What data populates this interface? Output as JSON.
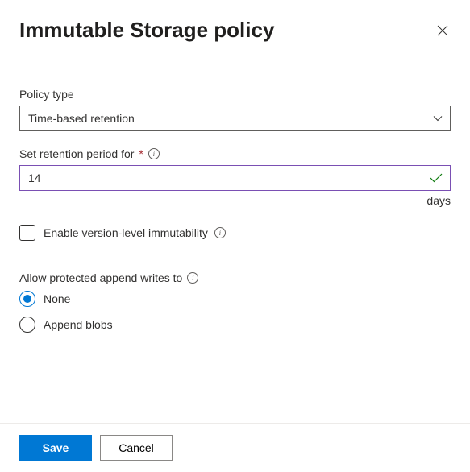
{
  "dialog": {
    "title": "Immutable Storage policy"
  },
  "fields": {
    "policy_type": {
      "label": "Policy type",
      "value": "Time-based retention"
    },
    "retention": {
      "label": "Set retention period for",
      "value": "14",
      "unit": "days"
    },
    "version_immutability": {
      "label": "Enable version-level immutability"
    },
    "append_writes": {
      "label": "Allow protected append writes to",
      "options": {
        "none": "None",
        "append_blobs": "Append blobs"
      },
      "selected": "none"
    }
  },
  "buttons": {
    "save": "Save",
    "cancel": "Cancel"
  }
}
